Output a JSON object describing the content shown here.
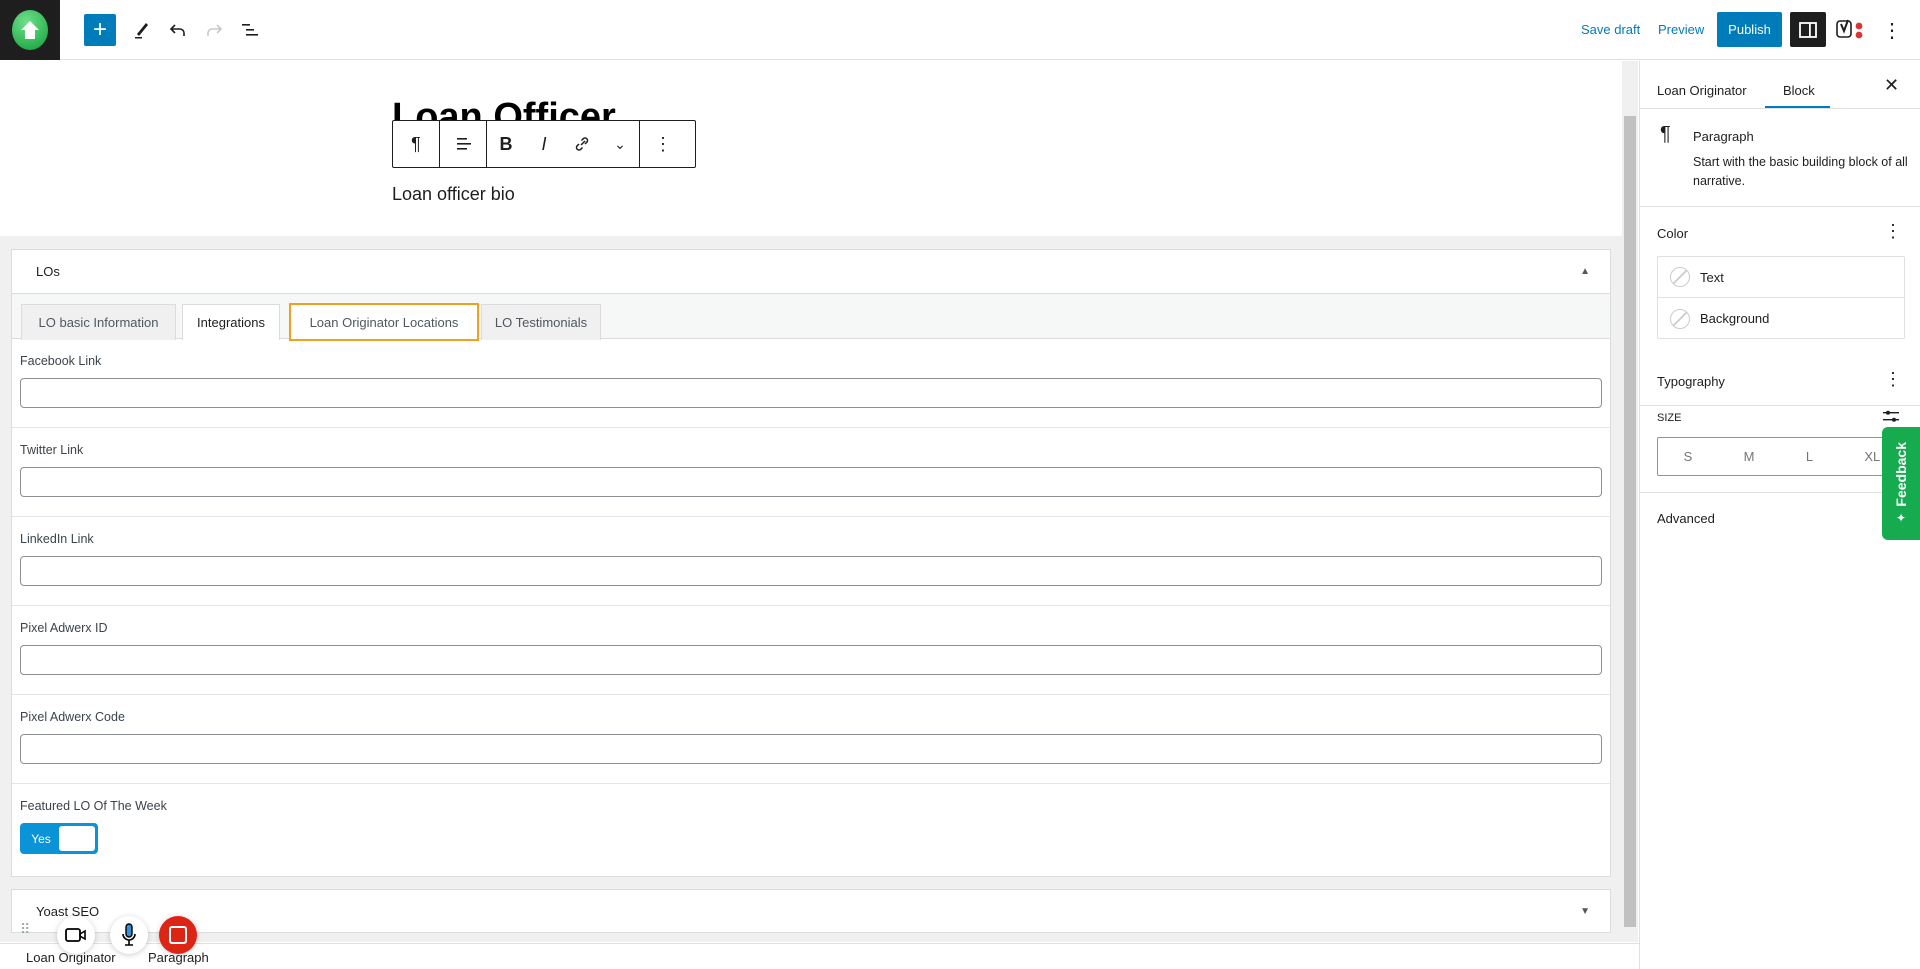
{
  "topbar": {
    "logo_icon": "house-logo-icon",
    "tools": [
      "add-block-icon",
      "pencil-icon",
      "undo-icon",
      "redo-icon",
      "list-view-icon"
    ],
    "save_draft": "Save draft",
    "preview": "Preview",
    "publish": "Publish",
    "accent": "#007cba"
  },
  "editor": {
    "title": "Loan Officer",
    "paragraph": "Loan officer bio",
    "toolbar_icons": [
      "pilcrow-icon",
      "align-icon",
      "bold-icon",
      "italic-icon",
      "link-icon",
      "chevron-down-icon",
      "more-vertical-icon"
    ],
    "toolbar_text": {
      "pilcrow": "¶",
      "bold": "B",
      "italic": "I"
    }
  },
  "metabox": {
    "title": "LOs",
    "tabs": [
      {
        "label": "LO basic Information",
        "state": "inactive"
      },
      {
        "label": "Integrations",
        "state": "active"
      },
      {
        "label": "Loan Originator Locations",
        "state": "focused"
      },
      {
        "label": "LO Testimonials",
        "state": "inactive"
      }
    ],
    "fields": [
      {
        "label": "Facebook Link",
        "value": ""
      },
      {
        "label": "Twitter Link",
        "value": ""
      },
      {
        "label": "LinkedIn Link",
        "value": ""
      },
      {
        "label": "Pixel Adwerx ID",
        "value": ""
      },
      {
        "label": "Pixel Adwerx Code",
        "value": ""
      }
    ],
    "featured": {
      "label": "Featured LO Of The Week",
      "toggle": "Yes",
      "on": true
    }
  },
  "yoast": {
    "title": "Yoast SEO"
  },
  "status": {
    "breadcrumb": [
      "Loan Originator",
      "Paragraph"
    ]
  },
  "sidebar": {
    "tabs": [
      {
        "label": "Loan Originator",
        "active": false
      },
      {
        "label": "Block",
        "active": true
      }
    ],
    "block": {
      "name": "Paragraph",
      "description": "Start with the basic building block of all narrative."
    },
    "color": {
      "title": "Color",
      "items": [
        "Text",
        "Background"
      ]
    },
    "typography": {
      "title": "Typography",
      "size_label": "SIZE",
      "sizes": [
        "S",
        "M",
        "L",
        "XL"
      ]
    },
    "advanced": "Advanced"
  },
  "feedback": {
    "label": "Feedback",
    "color": "#16ab4f"
  }
}
